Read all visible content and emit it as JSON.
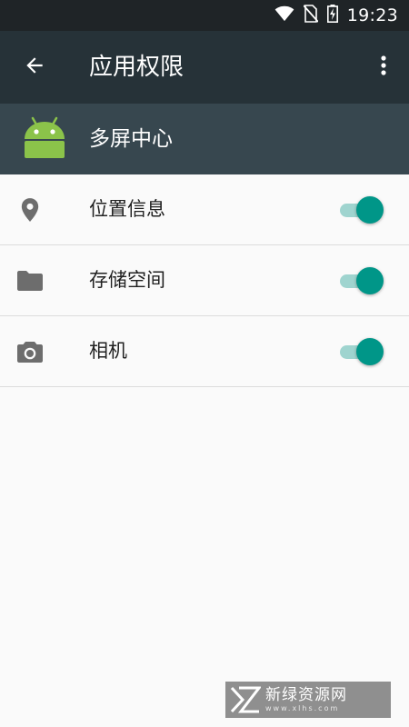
{
  "status_bar": {
    "time": "19:23",
    "icons": [
      "wifi-icon",
      "no-sim-icon",
      "battery-charging-icon"
    ]
  },
  "toolbar": {
    "title": "应用权限",
    "back_icon": "arrow-back-icon",
    "more_icon": "more-vert-icon"
  },
  "app": {
    "name": "多屏中心",
    "icon": "android-robot-icon"
  },
  "permissions": [
    {
      "label": "位置信息",
      "icon": "location-pin-icon",
      "enabled": true
    },
    {
      "label": "存储空间",
      "icon": "folder-icon",
      "enabled": true
    },
    {
      "label": "相机",
      "icon": "camera-icon",
      "enabled": true
    }
  ],
  "watermark": {
    "title": "新绿资源网",
    "subtitle": "www.xlhs.com"
  },
  "colors": {
    "status_bar": "#1f2427",
    "toolbar": "#263238",
    "app_header": "#37474f",
    "accent": "#009688",
    "toggle_track": "#9fd4cf",
    "background": "#fafafa"
  }
}
